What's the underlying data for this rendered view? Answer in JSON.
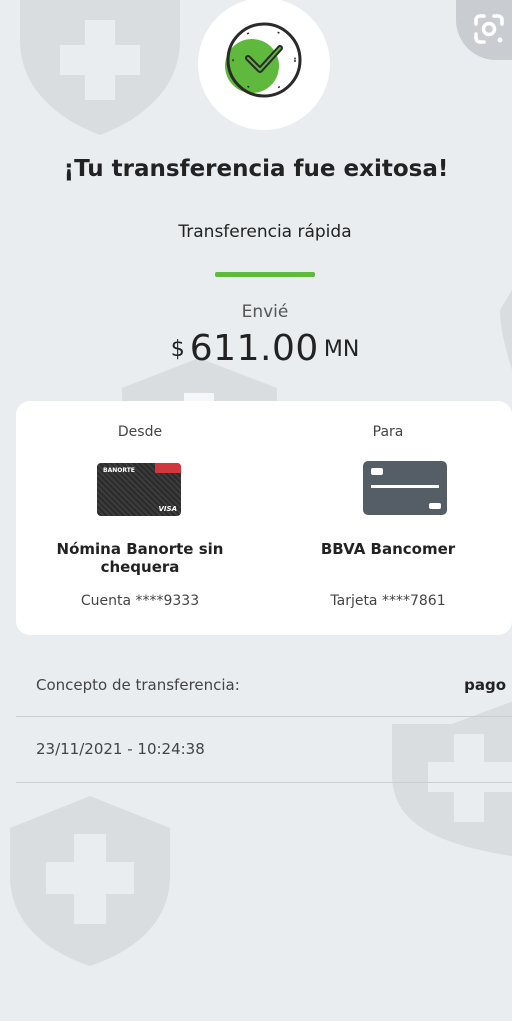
{
  "header": {
    "title": "¡Tu transferencia fue exitosa!",
    "subtitle": "Transferencia rápida",
    "icon": "check-clock-icon",
    "accent_color": "#5fb93c"
  },
  "amount": {
    "label": "Envié",
    "currency_symbol": "$",
    "value": "611.00",
    "currency_code": "MN"
  },
  "from": {
    "label": "Desde",
    "card_brand": "BANORTE",
    "card_network": "VISA",
    "name": "Nómina Banorte sin chequera",
    "account": "Cuenta ****9333"
  },
  "to": {
    "label": "Para",
    "card_icon": "credit-card-icon",
    "name": "BBVA Bancomer",
    "account": "Tarjeta ****7861"
  },
  "details": {
    "concept_label": "Concepto de transferencia:",
    "concept_value": "pago",
    "datetime": "23/11/2021 - 10:24:38"
  },
  "overlay": {
    "lens_icon": "google-lens-icon",
    "watermark_icon": "shield-cross-icon"
  }
}
